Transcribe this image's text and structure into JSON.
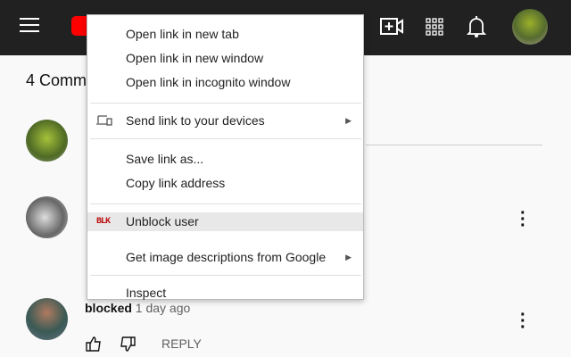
{
  "header": {
    "icons": [
      "menu-icon",
      "youtube-logo",
      "create-video-icon",
      "apps-icon",
      "notifications-icon",
      "avatar"
    ]
  },
  "comments": {
    "count_label": "4 Comm",
    "blocked_name": "blocked",
    "blocked_time": "1 day ago",
    "reply_label": "REPLY"
  },
  "context_menu": {
    "open_new_tab": "Open link in new tab",
    "open_new_window": "Open link in new window",
    "open_incognito": "Open link in incognito window",
    "send_to_devices": "Send link to your devices",
    "save_link_as": "Save link as...",
    "copy_link": "Copy link address",
    "unblock_user": "Unblock user",
    "unblock_icon_text": "BLK",
    "image_descriptions": "Get image descriptions from Google",
    "inspect": "Inspect"
  }
}
